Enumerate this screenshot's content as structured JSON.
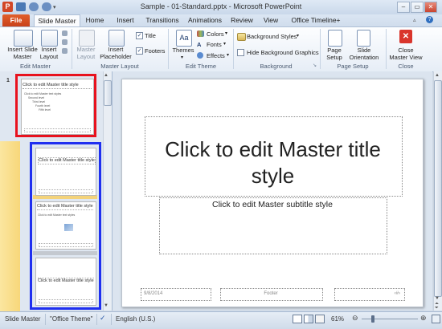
{
  "window": {
    "title": "Sample - 01-Standard.pptx - Microsoft PowerPoint"
  },
  "tabs": [
    {
      "label": "File"
    },
    {
      "label": "Slide Master"
    },
    {
      "label": "Home"
    },
    {
      "label": "Insert"
    },
    {
      "label": "Transitions"
    },
    {
      "label": "Animations"
    },
    {
      "label": "Review"
    },
    {
      "label": "View"
    },
    {
      "label": "Office Timeline+"
    }
  ],
  "ribbon": {
    "insert_slide_master": "Insert Slide Master",
    "insert_layout": "Insert Layout",
    "master_layout": "Master Layout",
    "insert_placeholder": "Insert Placeholder",
    "title_chk": "Title",
    "footers_chk": "Footers",
    "themes": "Themes",
    "colors": "Colors",
    "fonts": "Fonts",
    "effects": "Effects",
    "background_styles": "Background Styles",
    "hide_bg": "Hide Background Graphics",
    "page_setup": "Page Setup",
    "slide_orientation": "Slide Orientation",
    "close_master": "Close Master View",
    "groups": {
      "edit_master": "Edit Master",
      "master_layout": "Master Layout",
      "edit_theme": "Edit Theme",
      "background": "Background",
      "page_setup": "Page Setup",
      "close": "Close"
    }
  },
  "thumbnails": {
    "master_number": "1",
    "master_title": "Click to edit Master title style",
    "master_bullets": [
      "Click to edit Master text styles",
      "Second level",
      "Third level",
      "Fourth level",
      "Fifth level"
    ],
    "layout1_title": "Click to edit Master title style",
    "layout2_title": "Click to edit Master title style",
    "layout2_text": "Click to edit Master text styles",
    "layout3_title": "Click to edit Master title style"
  },
  "slide": {
    "title": "Click to edit Master title style",
    "subtitle": "Click to edit Master subtitle style",
    "date": "9/8/2014",
    "footer": "Footer",
    "number": "‹#›"
  },
  "status": {
    "view": "Slide Master",
    "theme": "\"Office Theme\"",
    "language": "English (U.S.)",
    "zoom": "61%"
  },
  "colors": {
    "file_tab": "#d4502a",
    "highlight_red": "#e8121e",
    "highlight_blue": "#1f2ff0",
    "close_red": "#d9352c"
  }
}
